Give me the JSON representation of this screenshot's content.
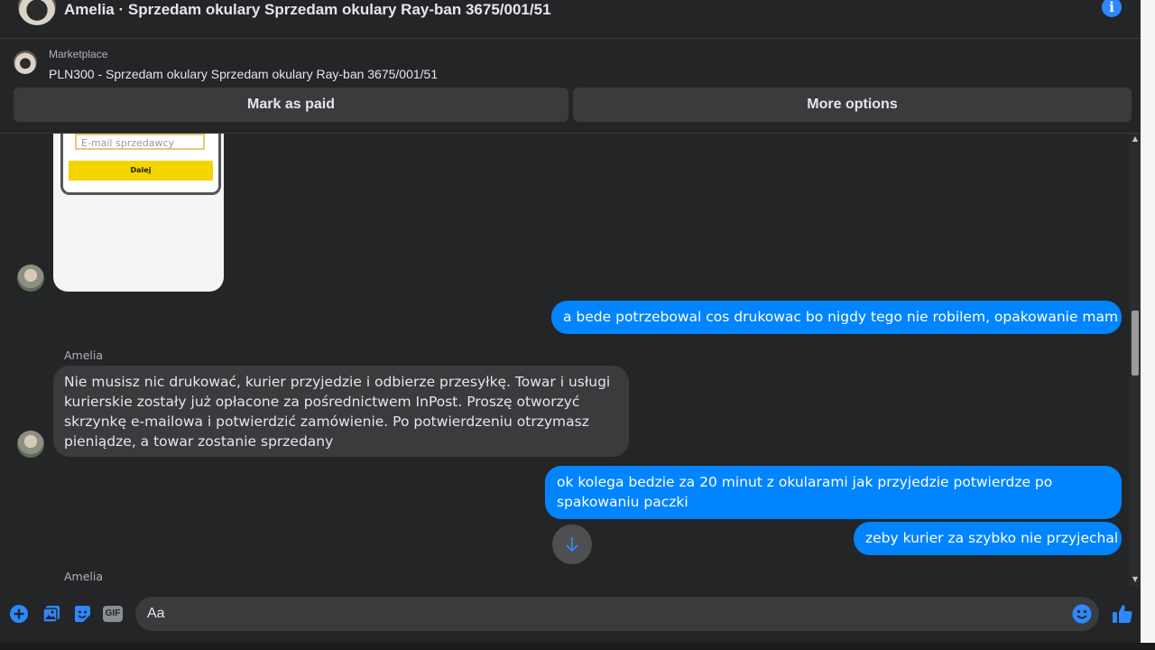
{
  "header": {
    "title": "Amelia · Sprzedam okulary Sprzedam okulary Ray-ban 3675/001/51",
    "info_glyph": "i"
  },
  "marketplace": {
    "label": "Marketplace",
    "item": "PLN300 - Sprzedam okulary Sprzedam okulary Ray-ban 3675/001/51",
    "mark_paid": "Mark as paid",
    "more_options": "More options"
  },
  "phone_image": {
    "email_placeholder": "E-mail sprzedawcy",
    "next_button": "Dalej"
  },
  "messages": [
    {
      "from": "me",
      "text": "a bede potrzebowal cos drukowac bo nigdy tego nie robilem, opakowanie mam"
    },
    {
      "from": "Amelia",
      "sender_label": "Amelia",
      "text": "Nie musisz nic drukować, kurier przyjedzie i odbierze przesyłkę. Towar i usługi kurierskie zostały już opłacone za pośrednictwem InPost. Proszę otworzyć skrzynkę e-mailowa i potwierdzić zamówienie. Po potwierdzeniu otrzymasz pieniądze, a towar zostanie sprzedany"
    },
    {
      "from": "me",
      "text": "ok kolega bedzie za 20 minut z okularami jak przyjedzie potwierdze po spakowaniu paczki"
    },
    {
      "from": "me",
      "text": "zeby kurier za szybko nie przyjechal"
    },
    {
      "from": "Amelia",
      "sender_label": "Amelia"
    }
  ],
  "composer": {
    "placeholder": "Aa",
    "gif_label": "GIF"
  },
  "colors": {
    "background": "#242526",
    "bubble_in": "#3a3b3c",
    "bubble_out": "#0084ff",
    "accent": "#2d88ff"
  },
  "icons": [
    "info-icon",
    "plus-icon",
    "image-icon",
    "sticker-icon",
    "gif-icon",
    "emoji-icon",
    "like-icon",
    "arrow-down-icon"
  ]
}
